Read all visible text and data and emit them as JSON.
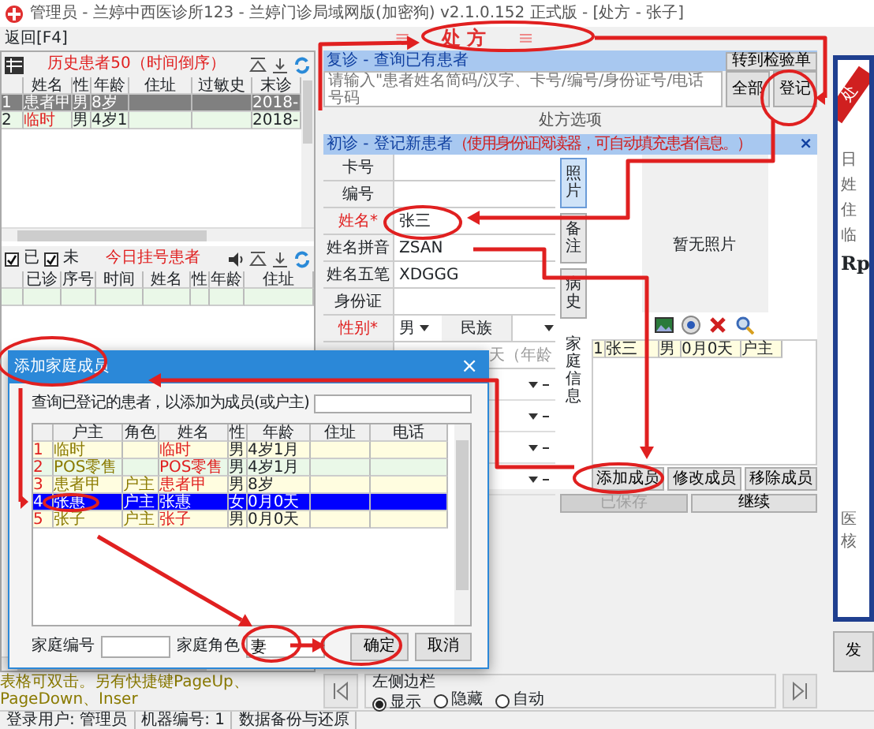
{
  "window": {
    "title": "管理员 - 兰婷中西医诊所123 - 兰婷门诊局域网版(加密狗) v2.1.0.152 正式版 - [处方 - 张子]"
  },
  "menu": {
    "back": "返回[F4]",
    "module_left": "≡",
    "module": "处 方",
    "module_right": "≡"
  },
  "history": {
    "title": "历史患者50（时间倒序）",
    "columns": [
      "姓名",
      "性",
      "年龄",
      "住址",
      "过敏史",
      "末诊"
    ],
    "rows": [
      {
        "no": "1",
        "name": "患者甲",
        "sex": "男",
        "age": "8岁",
        "last_visit": "2018-",
        "selected": true
      },
      {
        "no": "2",
        "name": "临时",
        "sex": "男",
        "age": "4岁1",
        "last_visit": "2018-",
        "selected": false
      }
    ]
  },
  "today": {
    "filters": [
      {
        "label": "已",
        "checked": true
      },
      {
        "label": "未",
        "checked": true
      }
    ],
    "title": "今日挂号患者",
    "columns": [
      "已诊",
      "序号",
      "时间",
      "姓名",
      "性",
      "年龄",
      "住址"
    ]
  },
  "revisit": {
    "title": "复诊 - 查询已有患者",
    "goto_button": "转到检验单",
    "search": {
      "placeholder": "请输入\"患者姓名简码/汉字、卡号/编号/身份证号/电话号码"
    },
    "buttons": [
      "全部",
      "登记"
    ],
    "options": "处方选项"
  },
  "new_patient": {
    "title": "初诊 - 登记新患者",
    "note": "（使用身份证阅读器，可自动填充患者信息。）",
    "close": "×",
    "fields": [
      {
        "label": "卡号",
        "required": false
      },
      {
        "label": "编号",
        "required": false
      },
      {
        "label": "姓名*",
        "required": true,
        "value": "张三"
      },
      {
        "label": "姓名拼音",
        "required": false,
        "value": "ZSAN"
      },
      {
        "label": "姓名五笔",
        "required": false,
        "value": "XDGGG"
      },
      {
        "label": "身份证",
        "required": false
      }
    ],
    "gender": {
      "label": "性别*",
      "value": "男",
      "ethnicity_label": "民族"
    },
    "age_note": "天（年龄",
    "side_tabs": [
      {
        "label": "照片",
        "selected": true
      },
      {
        "label": "备注",
        "selected": false
      },
      {
        "label": "病史",
        "selected": false
      }
    ],
    "family_label": "家庭信息",
    "photo": {
      "placeholder": "暂无照片"
    },
    "family": [
      {
        "no": "1",
        "name": "张三",
        "sex": "男",
        "age": "0月0天",
        "role": "户主"
      }
    ],
    "family_buttons": [
      "添加成员",
      "修改成员",
      "移除成员"
    ],
    "save_buttons": [
      {
        "label": "已保存",
        "disabled": true
      },
      {
        "label": "继续",
        "disabled": false
      }
    ]
  },
  "preview": {
    "ribbon": "处",
    "lines": [
      "日",
      "姓",
      "住",
      "临"
    ],
    "rp": "Rp",
    "footer": [
      "医",
      "核"
    ],
    "dispense": "发"
  },
  "dialog": {
    "title": "添加家庭成员",
    "close": "×",
    "query_label": "查询已登记的患者，以添加为成员(或户主)",
    "columns": [
      "户主",
      "角色",
      "姓名",
      "性",
      "年龄",
      "住址",
      "电话"
    ],
    "rows": [
      {
        "no": "1",
        "head": "临时",
        "name": "临时",
        "sex": "男",
        "age": "4岁1月",
        "selected": false
      },
      {
        "no": "2",
        "head": "POS零售",
        "name": "POS零售",
        "sex": "男",
        "age": "4岁1月",
        "selected": false
      },
      {
        "no": "3",
        "head": "患者甲",
        "role": "户主",
        "name": "患者甲",
        "sex": "男",
        "age": "8岁",
        "selected": false
      },
      {
        "no": "4",
        "head": "张惠",
        "role": "户主",
        "name": "张惠",
        "sex": "女",
        "age": "0月0天",
        "selected": true
      },
      {
        "no": "5",
        "head": "张子",
        "role": "户主",
        "name": "张子",
        "sex": "男",
        "age": "0月0天",
        "selected": false
      }
    ],
    "family_no_label": "家庭编号",
    "family_role_label": "家庭角色",
    "family_role_value": "妻",
    "buttons": [
      "确定",
      "取消"
    ]
  },
  "hint": "表格可双击。另有快捷键PageUp、PageDown、Inser",
  "sidebar": {
    "label": "左侧边栏",
    "options": [
      {
        "label": "显示",
        "selected": true
      },
      {
        "label": "隐藏",
        "selected": false
      },
      {
        "label": "自动",
        "selected": false
      }
    ]
  },
  "status_bar": [
    "登录用户: 管理员",
    "机器编号: 1",
    "数据备份与还原"
  ]
}
